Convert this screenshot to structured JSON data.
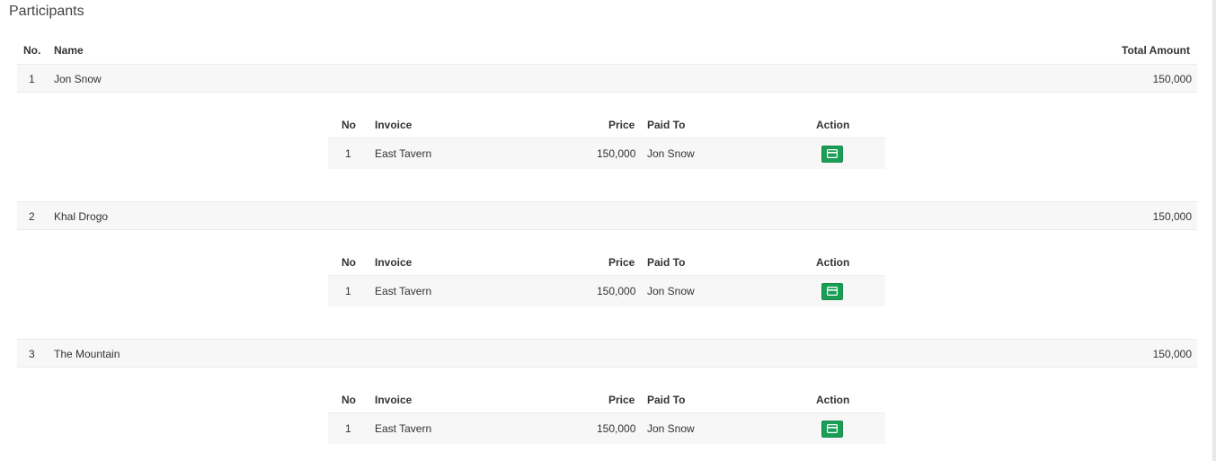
{
  "section": {
    "title": "Participants"
  },
  "participants_table": {
    "headers": {
      "no": "No.",
      "name": "Name",
      "total": "Total Amount"
    },
    "rows": [
      {
        "no": "1",
        "name": "Jon Snow",
        "total": "150,000",
        "details": {
          "headers": {
            "no": "No",
            "invoice": "Invoice",
            "price": "Price",
            "paid_to": "Paid To",
            "action": "Action"
          },
          "rows": [
            {
              "no": "1",
              "invoice": "East Tavern",
              "price": "150,000",
              "paid_to": "Jon Snow",
              "action_icon": "credit-card-icon"
            }
          ]
        }
      },
      {
        "no": "2",
        "name": "Khal Drogo",
        "total": "150,000",
        "details": {
          "headers": {
            "no": "No",
            "invoice": "Invoice",
            "price": "Price",
            "paid_to": "Paid To",
            "action": "Action"
          },
          "rows": [
            {
              "no": "1",
              "invoice": "East Tavern",
              "price": "150,000",
              "paid_to": "Jon Snow",
              "action_icon": "credit-card-icon"
            }
          ]
        }
      },
      {
        "no": "3",
        "name": "The Mountain",
        "total": "150,000",
        "details": {
          "headers": {
            "no": "No",
            "invoice": "Invoice",
            "price": "Price",
            "paid_to": "Paid To",
            "action": "Action"
          },
          "rows": [
            {
              "no": "1",
              "invoice": "East Tavern",
              "price": "150,000",
              "paid_to": "Jon Snow",
              "action_icon": "credit-card-icon"
            }
          ]
        }
      }
    ]
  },
  "colors": {
    "action_button": "#1a9e55",
    "row_background": "#f7f7f7"
  }
}
